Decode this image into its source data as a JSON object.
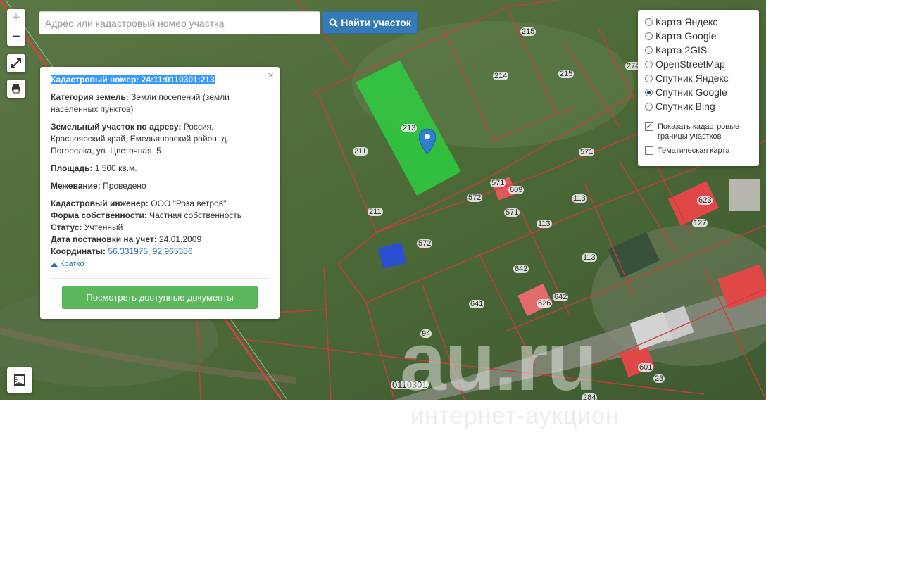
{
  "search": {
    "placeholder": "Адрес или кадастровый номер участка",
    "button_label": "Найти участок"
  },
  "map_controls": {
    "zoom_in": "+",
    "zoom_out": "−"
  },
  "info": {
    "close": "×",
    "cadastral_label": "Кадастровый номер:",
    "cadastral_value": "24:11:0110301:213",
    "category_label": "Категория земель:",
    "category_value": "Земли поселений (земли населенных пунктов)",
    "address_label": "Земельный участок по адресу:",
    "address_value": "Россия, Красноярский край, Емельяновский район, д. Погорелка, ул. Цветочная, 5",
    "area_label": "Площадь:",
    "area_value": "1 500 кв.м.",
    "survey_label": "Межевание:",
    "survey_value": "Проведено",
    "engineer_label": "Кадастровый инженер:",
    "engineer_value": "ООО \"Роза ветров\"",
    "ownership_label": "Форма собственности:",
    "ownership_value": "Частная собственность",
    "status_label": "Статус:",
    "status_value": "Учтенный",
    "date_label": "Дата постановки на учет:",
    "date_value": "24.01.2009",
    "coords_label": "Координаты:",
    "coords_value": "56.331975, 92.965386",
    "brief_link": "Кратко",
    "docs_button": "Посмотреть доступные документы"
  },
  "layers": {
    "options": [
      {
        "label": "Карта Яндекс",
        "selected": false
      },
      {
        "label": "Карта Google",
        "selected": false
      },
      {
        "label": "Карта 2GIS",
        "selected": false
      },
      {
        "label": "OpenStreetMap",
        "selected": false
      },
      {
        "label": "Спутник Яндекс",
        "selected": false
      },
      {
        "label": "Спутник Google",
        "selected": true
      },
      {
        "label": "Спутник Bing",
        "selected": false
      }
    ],
    "show_borders_label": "Показать кадастровые границы участков",
    "show_borders_checked": true,
    "thematic_label": "Тематическая карта",
    "thematic_checked": false
  },
  "parcel_labels": [
    "215",
    "214",
    "215",
    "274",
    "213",
    "211",
    "571",
    "571",
    "609",
    "572",
    "571",
    "113",
    "113",
    "623",
    "127",
    "572",
    "211",
    "642",
    "113",
    "626",
    "642",
    "641",
    "94",
    "601",
    "23",
    "284"
  ],
  "quarter_label": "0110301",
  "watermark": {
    "main": "au.ru",
    "sub": "интернет-аукцион"
  },
  "colors": {
    "selected_parcel": "#2ecc40",
    "parcel_border": "#d23a3a",
    "primary_button": "#337ab7",
    "success_button": "#5cb85c"
  }
}
